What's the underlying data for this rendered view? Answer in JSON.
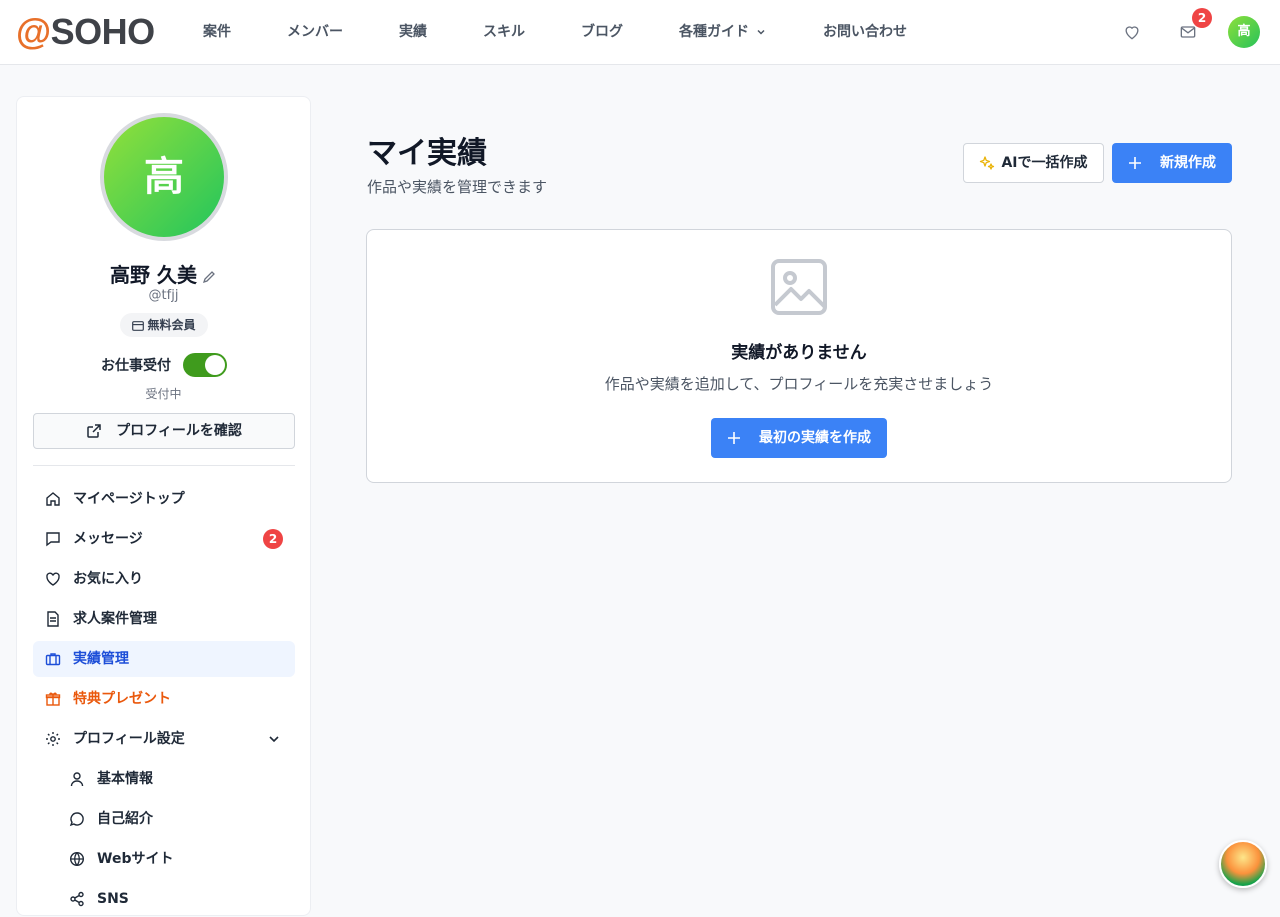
{
  "header": {
    "logo_at": "@",
    "logo_name": "SOHO",
    "nav": [
      "案件",
      "メンバー",
      "実績",
      "スキル",
      "ブログ",
      "各種ガイド",
      "お問い合わせ"
    ],
    "mail_badge": "2",
    "avatar_initial": "高"
  },
  "profile": {
    "avatar_initial": "高",
    "name": "高野 久美",
    "handle": "@tfjj",
    "member_type": "無料会員",
    "work_label": "お仕事受付",
    "work_status": "受付中",
    "work_enabled": true,
    "view_profile_label": "プロフィールを確認"
  },
  "menu": {
    "items": [
      {
        "label": "マイページトップ",
        "icon": "home-icon"
      },
      {
        "label": "メッセージ",
        "icon": "message-icon",
        "badge": "2"
      },
      {
        "label": "お気に入り",
        "icon": "heart-icon"
      },
      {
        "label": "求人案件管理",
        "icon": "document-icon"
      },
      {
        "label": "実績管理",
        "icon": "briefcase-icon",
        "active": true
      },
      {
        "label": "特典プレゼント",
        "icon": "gift-icon"
      },
      {
        "label": "プロフィール設定",
        "icon": "gear-icon"
      }
    ],
    "sub_items": [
      {
        "label": "基本情報",
        "icon": "user-icon"
      },
      {
        "label": "自己紹介",
        "icon": "chat-bubble-icon"
      },
      {
        "label": "Webサイト",
        "icon": "globe-icon"
      },
      {
        "label": "SNS",
        "icon": "share-icon"
      }
    ]
  },
  "main": {
    "title": "マイ実績",
    "subtitle": "作品や実績を管理できます",
    "ai_button": "AIで一括作成",
    "new_button": "新規作成",
    "empty_title": "実績がありません",
    "empty_desc": "作品や実績を追加して、プロフィールを充実させましょう",
    "first_button": "最初の実績を作成"
  },
  "colors": {
    "primary": "#3b82f6",
    "active_bg": "#eff5ff",
    "active_text": "#1d4ed8",
    "gift": "#ea580c",
    "toggle_on": "#3f9b1d",
    "badge": "#ef4444",
    "logo_accent": "#e8702a"
  }
}
